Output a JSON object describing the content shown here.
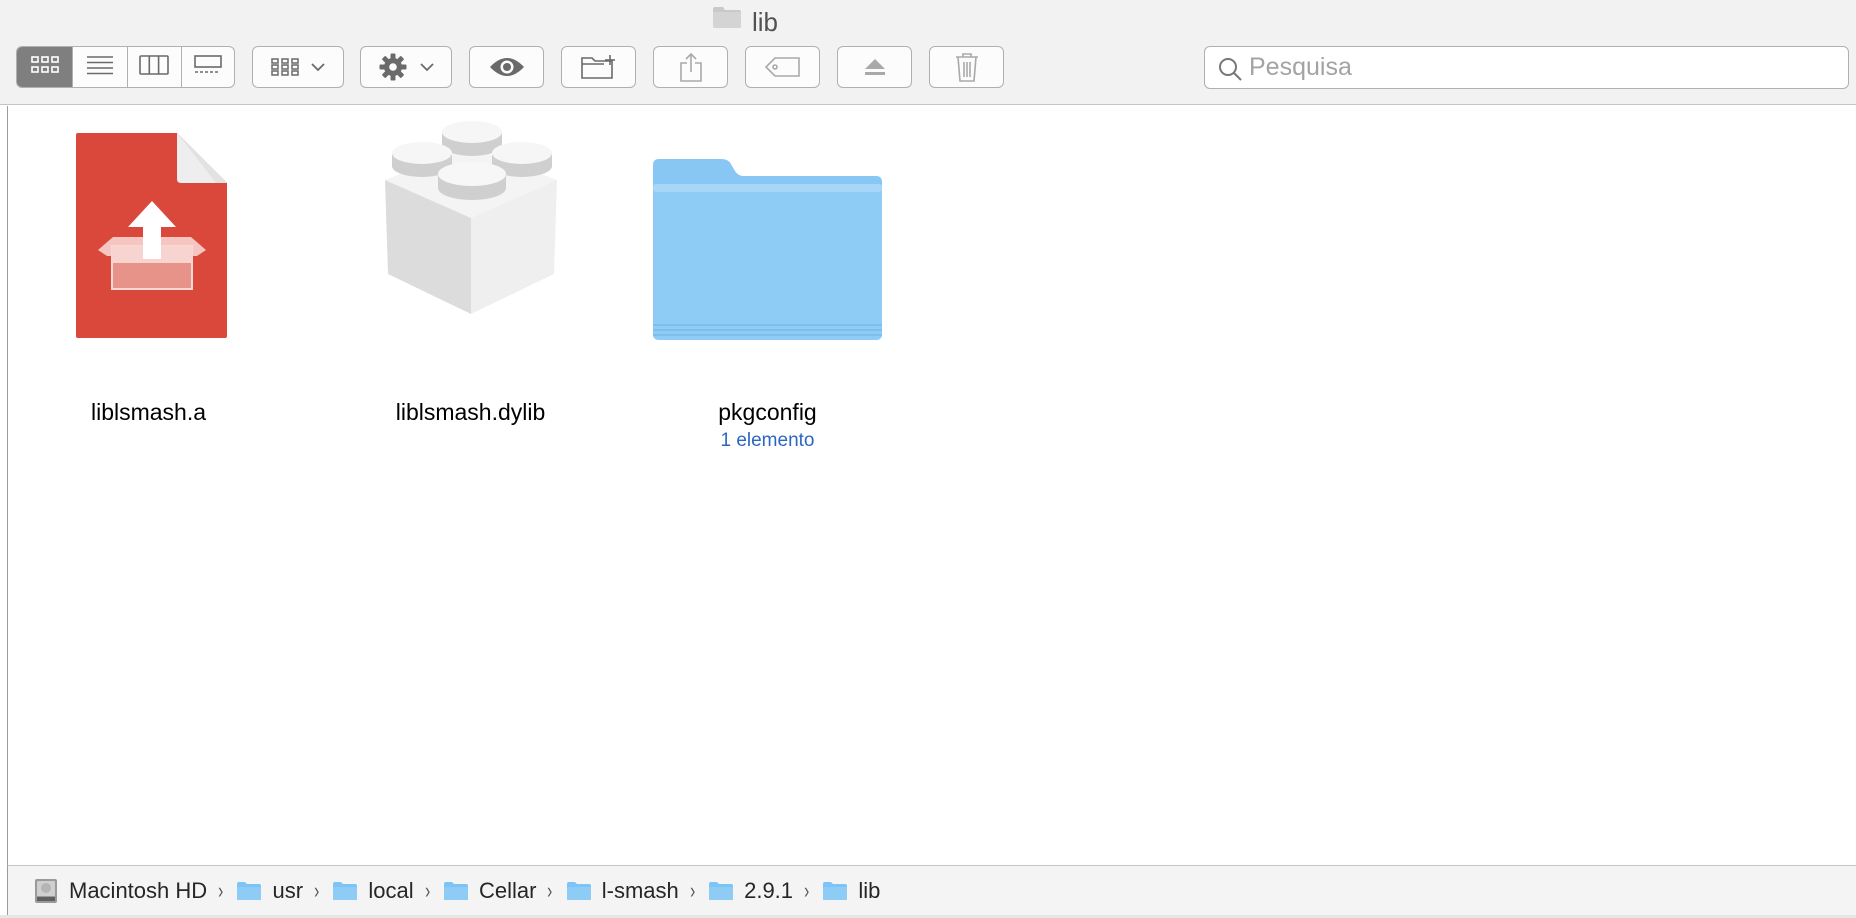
{
  "window": {
    "title": "lib",
    "title_icon": "folder-icon"
  },
  "toolbar": {
    "view_buttons": [
      {
        "name": "icon-view-icon",
        "active": true
      },
      {
        "name": "list-view-icon",
        "active": false
      },
      {
        "name": "column-view-icon",
        "active": false
      },
      {
        "name": "gallery-view-icon",
        "active": false
      }
    ],
    "group_icon": "group-grid-icon",
    "action_icon": "gear-icon",
    "quicklook_icon": "eye-icon",
    "new_folder_icon": "new-folder-icon",
    "share_icon": "share-icon",
    "tags_icon": "tag-icon",
    "eject_icon": "eject-icon",
    "trash_icon": "trash-icon",
    "search": {
      "placeholder": "Pesquisa",
      "value": ""
    }
  },
  "files": [
    {
      "name": "liblsmash.a",
      "kind": "archive",
      "icon": "archive-file-icon",
      "subtitle": ""
    },
    {
      "name": "liblsmash.dylib",
      "kind": "library",
      "icon": "library-lego-icon",
      "subtitle": ""
    },
    {
      "name": "pkgconfig",
      "kind": "folder",
      "icon": "folder-icon",
      "subtitle": "1 elemento"
    }
  ],
  "path": [
    {
      "label": "Macintosh HD",
      "icon": "hard-drive-icon"
    },
    {
      "label": "usr",
      "icon": "folder-icon"
    },
    {
      "label": "local",
      "icon": "folder-icon"
    },
    {
      "label": "Cellar",
      "icon": "folder-icon"
    },
    {
      "label": "l-smash",
      "icon": "folder-icon"
    },
    {
      "label": "2.9.1",
      "icon": "folder-icon"
    },
    {
      "label": "lib",
      "icon": "folder-icon"
    }
  ],
  "path_separator": "›",
  "colors": {
    "folder_blue": "#7cc4f5",
    "archive_red": "#d9483b",
    "selected_segment": "#7f7f7f",
    "subtitle_blue": "#2d66c1"
  }
}
